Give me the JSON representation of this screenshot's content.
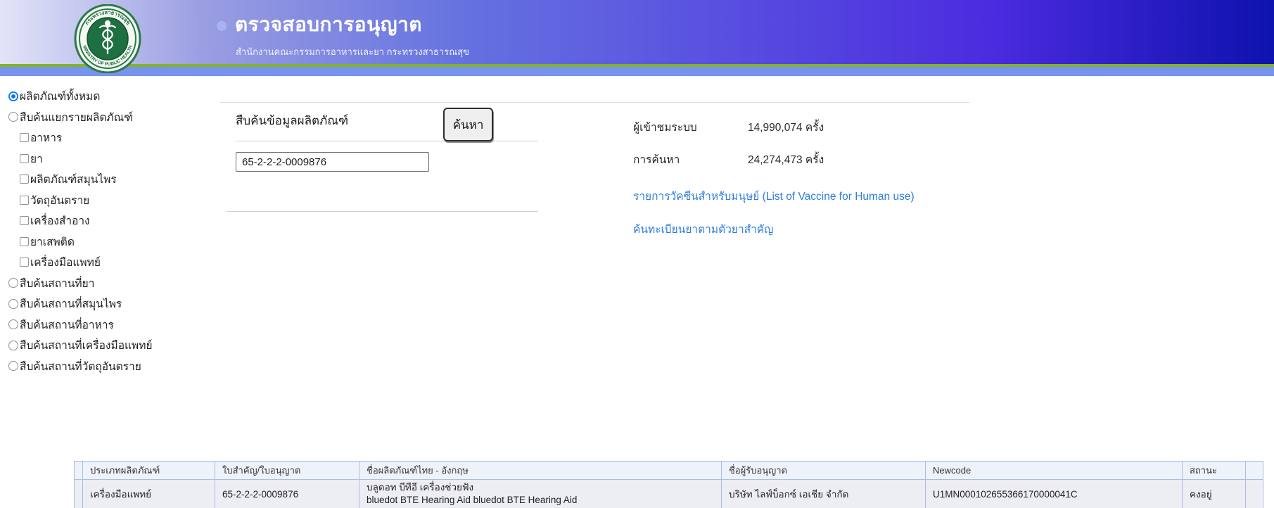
{
  "header": {
    "title": "ตรวจสอบการอนุญาต",
    "subtitle": "สำนักงานคณะกรรมการอาหารและยา กระทรวงสาธารณสุข",
    "logo_top_text": "กระทรวงสาธารณสุข",
    "logo_bottom_text": "MINISTRY OF PUBLIC HEALTH",
    "colors": {
      "gradient_left": "#e2e4f8",
      "gradient_right": "#0e12ae",
      "green_stripe": "#85b229",
      "blue_stripe": "#7693ee",
      "logo_green": "#1e6f41"
    }
  },
  "sidebar": {
    "items": [
      {
        "type": "radio",
        "label": "ผลิตภัณฑ์ทั้งหมด",
        "selected": true,
        "indent": false
      },
      {
        "type": "radio",
        "label": "สืบค้นแยกรายผลิตภัณฑ์",
        "selected": false,
        "indent": false
      },
      {
        "type": "checkbox",
        "label": "อาหาร",
        "selected": false,
        "indent": true
      },
      {
        "type": "checkbox",
        "label": "ยา",
        "selected": false,
        "indent": true
      },
      {
        "type": "checkbox",
        "label": "ผลิตภัณฑ์สมุนไพร",
        "selected": false,
        "indent": true
      },
      {
        "type": "checkbox",
        "label": "วัตถุอันตราย",
        "selected": false,
        "indent": true
      },
      {
        "type": "checkbox",
        "label": "เครื่องสำอาง",
        "selected": false,
        "indent": true
      },
      {
        "type": "checkbox",
        "label": "ยาเสพติด",
        "selected": false,
        "indent": true
      },
      {
        "type": "checkbox",
        "label": "เครื่องมือแพทย์",
        "selected": false,
        "indent": true
      },
      {
        "type": "radio",
        "label": "สืบค้นสถานที่ยา",
        "selected": false,
        "indent": false
      },
      {
        "type": "radio",
        "label": "สืบค้นสถานที่สมุนไพร",
        "selected": false,
        "indent": false
      },
      {
        "type": "radio",
        "label": "สืบค้นสถานที่อาหาร",
        "selected": false,
        "indent": false
      },
      {
        "type": "radio",
        "label": "สืบค้นสถานที่เครื่องมือแพทย์",
        "selected": false,
        "indent": false
      },
      {
        "type": "radio",
        "label": "สืบค้นสถานที่วัตถุอันตราย",
        "selected": false,
        "indent": false
      }
    ]
  },
  "search": {
    "label": "สืบค้นข้อมูลผลิตภัณฑ์",
    "input_value": "65-2-2-2-0009876",
    "button_label": "ค้นหา"
  },
  "stats": {
    "visitors_label": "ผู้เข้าชมระบบ",
    "visitors_value": "14,990,074 ครั้ง",
    "searches_label": "การค้นหา",
    "searches_value": "24,274,473 ครั้ง"
  },
  "links": {
    "vaccine_list": "รายการวัคซีนสำหรับมนุษย์ (List of Vaccine for Human use)",
    "drug_registry": "ค้นทะเบียนยาตามตัวยาสำคัญ"
  },
  "table": {
    "columns": [
      "ประเภทผลิตภัณฑ์",
      "ใบสำคัญ/ใบอนุญาต",
      "ชื่อผลิตภัณฑ์ไทย - อังกฤษ",
      "ชื่อผู้รับอนุญาต",
      "Newcode",
      "สถานะ"
    ],
    "rows": [
      {
        "product_type": "เครื่องมือแพทย์",
        "license_no": "65-2-2-2-0009876",
        "product_name_th": "บลูดอท บีทีอี เครื่องช่วยฟัง",
        "product_name_en": "bluedot BTE Hearing Aid bluedot BTE Hearing Aid",
        "licensee": "บริษัท ไลฟ์บ็อกซ์ เอเชีย จำกัด",
        "newcode": "U1MN000102655366170000041C",
        "status": "คงอยู่"
      }
    ]
  }
}
